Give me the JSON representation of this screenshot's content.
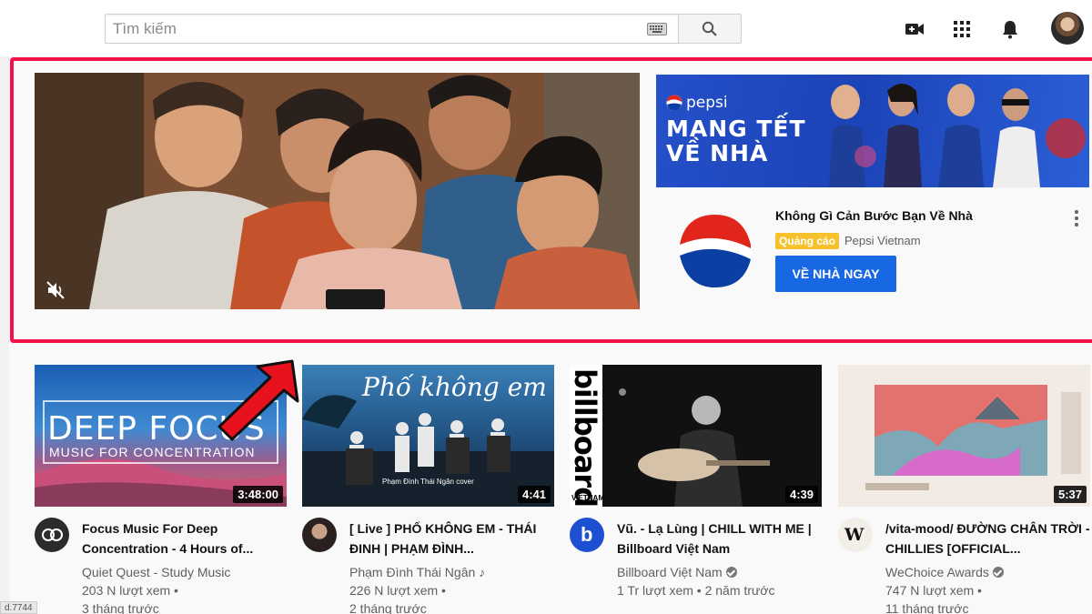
{
  "header": {
    "search_placeholder": "Tìm kiếm",
    "icons": [
      "keyboard-icon",
      "search-icon",
      "video-camera-icon",
      "apps-grid-icon",
      "bell-icon"
    ]
  },
  "ad": {
    "banner_brand": "pepsi",
    "banner_title_line1": "MANG TẾT",
    "banner_title_line2": "VỀ NHÀ",
    "title": "Không Gì Cản Bước Bạn Về Nhà",
    "badge": "Quảng cáo",
    "channel": "Pepsi Vietnam",
    "cta": "VỀ NHÀ NGAY",
    "frame_color": "#f5124a",
    "cta_color": "#1868e3"
  },
  "videos": [
    {
      "thumb_line1": "DEEP FOCUS",
      "thumb_line2": "MUSIC FOR CONCENTRATION",
      "duration": "3:48:00",
      "title": "Focus Music For Deep Concentration - 4 Hours of...",
      "channel": "Quiet Quest - Study Music",
      "views": "203 N lượt xem •",
      "age": "3 tháng trước"
    },
    {
      "thumb_line1": "Phố không em",
      "thumb_line2": "Phạm Đình Thái Ngân cover",
      "duration": "4:41",
      "title": "[ Live ] PHỐ KHÔNG EM - THÁI ĐINH | PHẠM ĐÌNH...",
      "channel": "Phạm Đình Thái Ngân ♪",
      "views": "226 N lượt xem •",
      "age": "2 tháng trước"
    },
    {
      "thumb_line1": "billboard",
      "thumb_line2": "VIETNAM",
      "duration": "4:39",
      "title": "Vũ. - Lạ Lùng | CHILL WITH ME | Billboard Việt Nam",
      "channel": "Billboard Việt Nam",
      "views": "1 Tr lượt xem • 2 năm trước",
      "age": ""
    },
    {
      "thumb_line1": "",
      "thumb_line2": "",
      "duration": "5:37",
      "title": "/vita-mood/ ĐƯỜNG CHÂN TRỜI - CHILLIES [OFFICIAL...",
      "channel": "WeChoice Awards",
      "views": "747 N lượt xem •",
      "age": "11 tháng trước"
    }
  ],
  "status": "d.7744"
}
